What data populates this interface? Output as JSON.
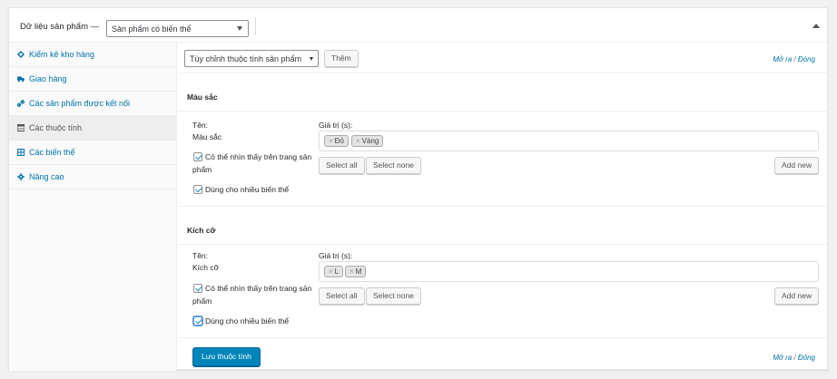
{
  "header": {
    "title": "Dữ liệu sản phẩm —",
    "product_type": "Sản phẩm có biến thể"
  },
  "tabs": [
    {
      "label": "Kiểm kê kho hàng",
      "icon": "inventory-icon"
    },
    {
      "label": "Giao hàng",
      "icon": "truck-icon"
    },
    {
      "label": "Các sản phẩm được kết nối",
      "icon": "link-icon"
    },
    {
      "label": "Các thuộc tính",
      "icon": "table-icon"
    },
    {
      "label": "Các biến thể",
      "icon": "grid-icon"
    },
    {
      "label": "Nâng cao",
      "icon": "gear-icon"
    }
  ],
  "toolbar": {
    "attribute_select": "Tùy chỉnh thuộc tính sản phẩm",
    "add_label": "Thêm",
    "expand": "Mở ra",
    "sep": " / ",
    "collapse": "Đóng"
  },
  "attributes": [
    {
      "title": "Màu sắc",
      "name_label": "Tên:",
      "name_value": "Màu sắc",
      "values_label": "Giá trị (s):",
      "values": [
        "Đỏ",
        "Vàng"
      ],
      "visible_label_1": "Có thể nhìn thấy trên trang sản",
      "visible_label_2": "phẩm",
      "variation_label": "Dùng cho nhiều biến thể",
      "select_all": "Select all",
      "select_none": "Select none",
      "add_new": "Add new"
    },
    {
      "title": "Kích cỡ",
      "name_label": "Tên:",
      "name_value": "Kích cỡ",
      "values_label": "Giá trị (s):",
      "values": [
        "L",
        "M"
      ],
      "visible_label_1": "Có thể nhìn thấy trên trang sản",
      "visible_label_2": "phẩm",
      "variation_label": "Dùng cho nhiều biến thể",
      "select_all": "Select all",
      "select_none": "Select none",
      "add_new": "Add new"
    }
  ],
  "footer": {
    "save_label": "Lưu thuộc tính",
    "expand": "Mở ra",
    "sep": " / ",
    "collapse": "Đóng"
  },
  "chip_remove": "×",
  "colors": {
    "accent": "#0073aa",
    "primary": "#0085ba"
  }
}
